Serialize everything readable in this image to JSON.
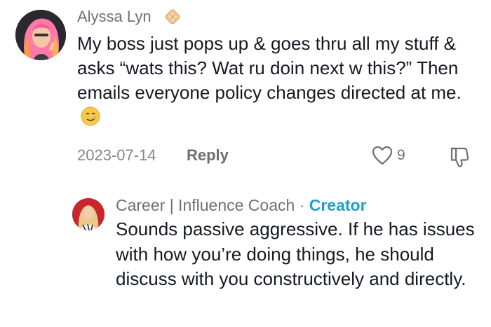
{
  "comment": {
    "username": "Alyssa Lyn",
    "text": "My boss just pops up & goes thru all my stuff & asks “wats this? Wat ru doin next w this?” Then emails everyone policy changes directed at me.",
    "date": "2023-07-14",
    "reply_label": "Reply",
    "like_count": "9"
  },
  "reply": {
    "username": "Career | Influence Coach",
    "separator": " · ",
    "creator_label": "Creator",
    "text": "Sounds passive aggressive. If he has issues with how you’re doing things, he should discuss with you constructively and directly."
  },
  "colors": {
    "text": "#161823",
    "muted": "#6f6f75",
    "creator": "#20a0c8"
  },
  "icons": {
    "badge": "badge-icon",
    "emoji": "smiling-face-with-tear-emoji",
    "like": "heart-outline-icon",
    "dislike": "thumbs-down-icon"
  }
}
